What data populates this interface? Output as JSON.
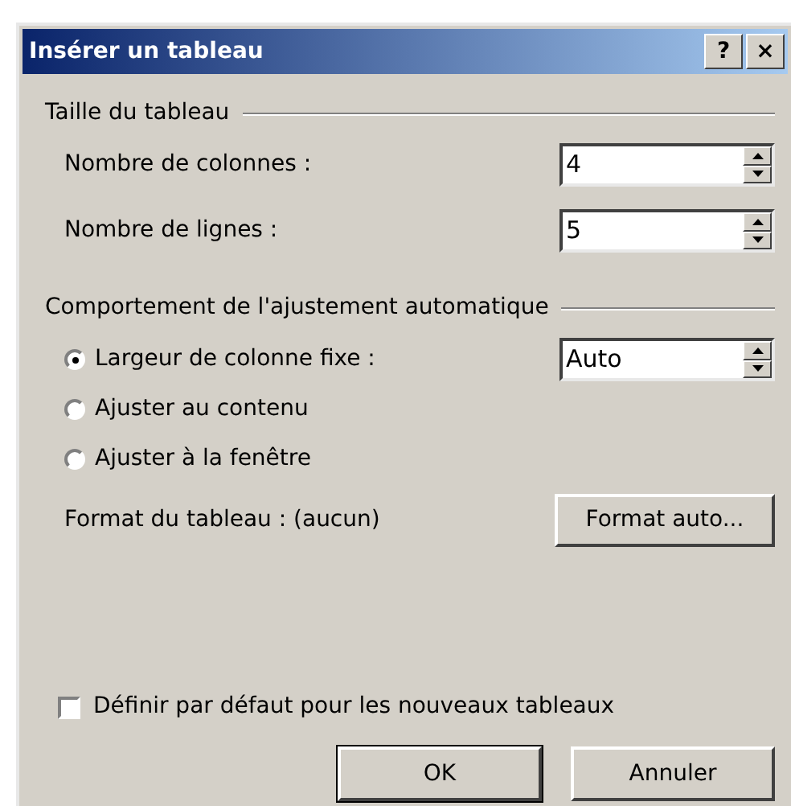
{
  "window": {
    "title": "Insérer un tableau",
    "title_buttons": [
      "?",
      "×"
    ]
  },
  "size_group": {
    "title": "Taille du tableau",
    "fields": [
      {
        "label": "Nombre de colonnes :",
        "value": "4"
      },
      {
        "label": "Nombre de lignes :",
        "value": "5"
      }
    ]
  },
  "autofit_group": {
    "title": "Comportement de l'ajustement automatique",
    "options": [
      {
        "label": "Largeur de colonne fixe :",
        "selected": true,
        "value": "Auto"
      },
      {
        "label": "Ajuster au contenu",
        "selected": false
      },
      {
        "label": "Ajuster à la fenêtre",
        "selected": false
      }
    ],
    "format_label": "Format du tableau : (aucun)",
    "format_button": "Format auto..."
  },
  "default_checkbox": {
    "label": "Définir par défaut pour les nouveaux tableaux",
    "checked": false
  },
  "buttons": [
    "OK",
    "Annuler"
  ]
}
